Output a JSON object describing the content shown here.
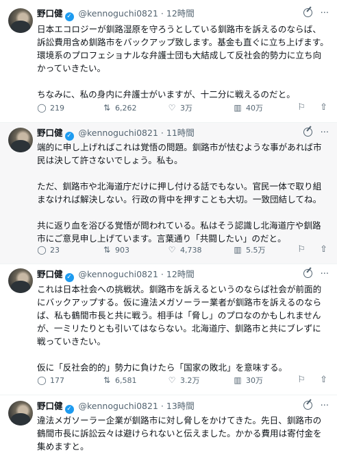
{
  "tweets": [
    {
      "name": "野口健",
      "handle": "@kennoguchi0821",
      "dot": "·",
      "time": "12時間",
      "text": "日本エコロジーが釧路湿原を守ろうとしている釧路市を訴えるのならば、訴訟費用含め釧路市をバックアップ致します。基金も直ぐに立ち上げます。環境系のプロフェショナルな弁護士団も大結成して反社会的勢力に立ち向かっていきたい。\n\nちなみに、私の身内に弁護士がいますが、十二分に戦えるのだと。",
      "replies": "219",
      "retweets": "6,262",
      "likes": "3万",
      "views": "40万"
    },
    {
      "name": "野口健",
      "handle": "@kennoguchi0821",
      "dot": "·",
      "time": "11時間",
      "text": "端的に申し上げればこれは覚悟の問題。釧路市が怯むような事があれば市民は決して許さないでしょう。私も。\n\nただ、釧路市や北海道庁だけに押し付ける話でもない。官民一体で取り組まなければ解決しない。行政の背中を押すことも大切。一致団結してね。\n\n共に返り血を浴びる覚悟が問われている。私はそう認識し北海道庁や釧路市にご意見申し上げています。言葉通り「共闘したい」のだと。",
      "replies": "23",
      "retweets": "903",
      "likes": "4,738",
      "views": "5.5万"
    },
    {
      "name": "野口健",
      "handle": "@kennoguchi0821",
      "dot": "·",
      "time": "12時間",
      "text": "これは日本社会への挑戦状。釧路市を訴えるというのならば社会が前面的にバックアップする。仮に違法メガソーラー業者が釧路市を訴えるのならば、私も鶴間市長と共に戦う。相手は「脅し」のプロなのかもしれませんが、一ミリたりとも引いてはならない。北海道庁、釧路市と共にブレずに戦っていきたい。\n\n仮に「反社会的的」勢力に負けたら「国家の敗北」を意味する。",
      "replies": "177",
      "retweets": "6,581",
      "likes": "3.2万",
      "views": "30万"
    },
    {
      "name": "野口健",
      "handle": "@kennoguchi0821",
      "dot": "·",
      "time": "13時間",
      "text": "違法メガソーラー企業が釧路市に対し脅しをかけてきた。先日、釧路市の鶴間市長に訴訟云々は避けられないと伝えました。かかる費用は寄付金を集めますと。"
    }
  ]
}
